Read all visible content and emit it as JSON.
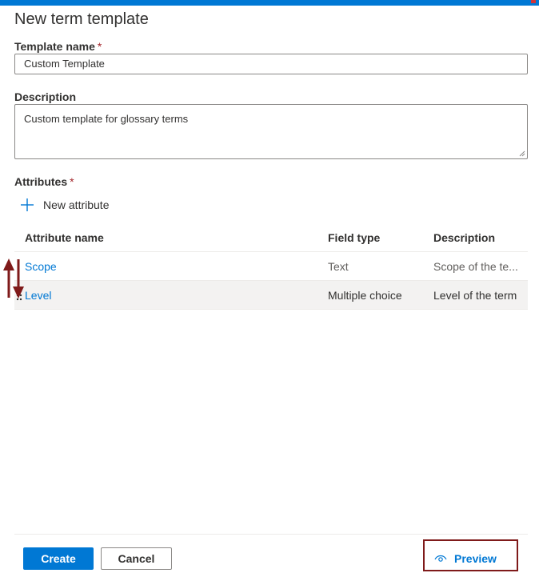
{
  "header": {
    "title": "New term template"
  },
  "form": {
    "template_name": {
      "label": "Template name",
      "required_mark": "*",
      "value": "Custom Template"
    },
    "description": {
      "label": "Description",
      "value": "Custom template for glossary terms"
    },
    "attributes": {
      "label": "Attributes",
      "required_mark": "*"
    }
  },
  "toolbar": {
    "new_attribute_label": "New attribute"
  },
  "table": {
    "columns": [
      "Attribute name",
      "Field type",
      "Description"
    ],
    "rows": [
      {
        "name": "Scope",
        "field_type": "Text",
        "description": "Scope of the te..."
      },
      {
        "name": "Level",
        "field_type": "Multiple choice",
        "description": "Level of the term"
      }
    ]
  },
  "footer": {
    "create_label": "Create",
    "cancel_label": "Cancel",
    "preview_label": "Preview"
  },
  "colors": {
    "accent": "#0078d4",
    "highlight_border": "#7f1a1a",
    "required": "#a4262c"
  },
  "icons": {
    "new_attribute": "plus-icon",
    "drag": "drag-handle-icon",
    "preview": "eye-icon",
    "reorder": "reorder-arrows-icon"
  }
}
